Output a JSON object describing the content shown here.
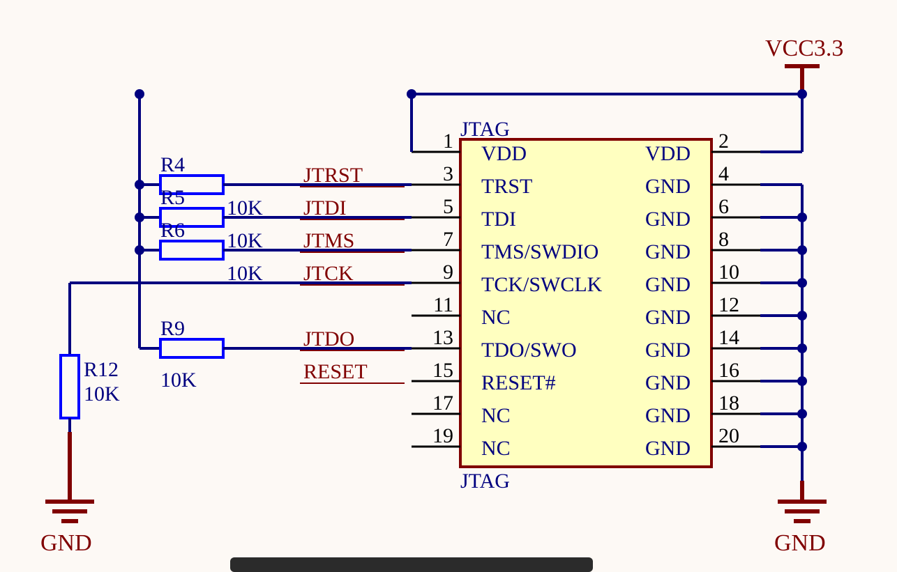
{
  "power": {
    "vcc": "VCC3.3",
    "gnd_left": "GND",
    "gnd_right": "GND"
  },
  "component": {
    "name_top": "JTAG",
    "name_bottom": "JTAG"
  },
  "pins_left": [
    {
      "num": "1",
      "name": "VDD"
    },
    {
      "num": "3",
      "name": "TRST"
    },
    {
      "num": "5",
      "name": "TDI"
    },
    {
      "num": "7",
      "name": "TMS/SWDIO"
    },
    {
      "num": "9",
      "name": "TCK/SWCLK"
    },
    {
      "num": "11",
      "name": "NC"
    },
    {
      "num": "13",
      "name": "TDO/SWO"
    },
    {
      "num": "15",
      "name": "RESET#"
    },
    {
      "num": "17",
      "name": "NC"
    },
    {
      "num": "19",
      "name": "NC"
    }
  ],
  "pins_right": [
    {
      "num": "2",
      "name": "VDD"
    },
    {
      "num": "4",
      "name": "GND"
    },
    {
      "num": "6",
      "name": "GND"
    },
    {
      "num": "8",
      "name": "GND"
    },
    {
      "num": "10",
      "name": "GND"
    },
    {
      "num": "12",
      "name": "GND"
    },
    {
      "num": "14",
      "name": "GND"
    },
    {
      "num": "16",
      "name": "GND"
    },
    {
      "num": "18",
      "name": "GND"
    },
    {
      "num": "20",
      "name": "GND"
    }
  ],
  "nets": {
    "jtrst": "JTRST",
    "jtdi": "JTDI",
    "jtms": "JTMS",
    "jtck": "JTCK",
    "jtdo": "JTDO",
    "reset": "RESET"
  },
  "resistors": {
    "r4": {
      "des": "R4",
      "val": ""
    },
    "r5": {
      "des": "R5",
      "val": "10K"
    },
    "r6": {
      "des": "R6",
      "val": "10K"
    },
    "r7": {
      "des": "",
      "val": "10K"
    },
    "r9": {
      "des": "R9",
      "val": "10K"
    },
    "r12": {
      "des": "R12",
      "val": "10K"
    }
  }
}
